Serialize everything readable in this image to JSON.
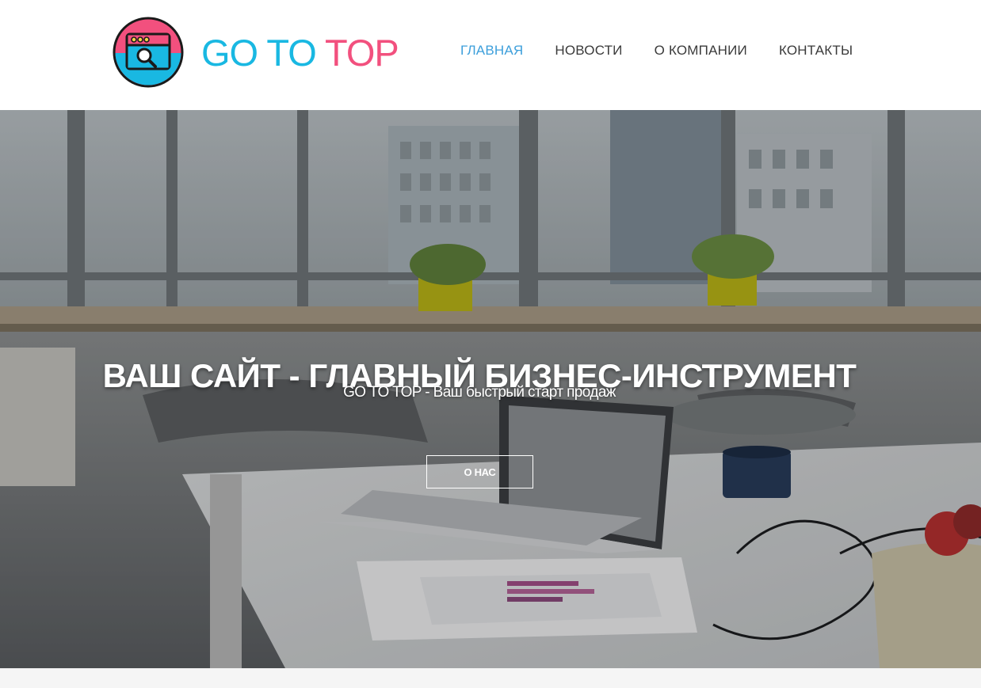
{
  "brand": {
    "word1": "GO",
    "word2": "TO",
    "word3": "TOP",
    "colors": {
      "blue": "#19b8e2",
      "pink": "#f2507e"
    },
    "logo_icon": "browser-search-icon"
  },
  "nav": {
    "items": [
      {
        "label": "ГЛАВНАЯ",
        "active": true
      },
      {
        "label": "НОВОСТИ",
        "active": false
      },
      {
        "label": "О КОМПАНИИ",
        "active": false
      },
      {
        "label": "КОНТАКТЫ",
        "active": false
      }
    ],
    "active_color": "#3d9fdb"
  },
  "hero": {
    "title": "ВАШ САЙТ - ГЛАВНЫЙ БИЗНЕС-ИНСТРУМЕНТ",
    "subtitle": "GO TO TOP - Ваш быстрый старт продаж",
    "button_label": "О НАС"
  }
}
